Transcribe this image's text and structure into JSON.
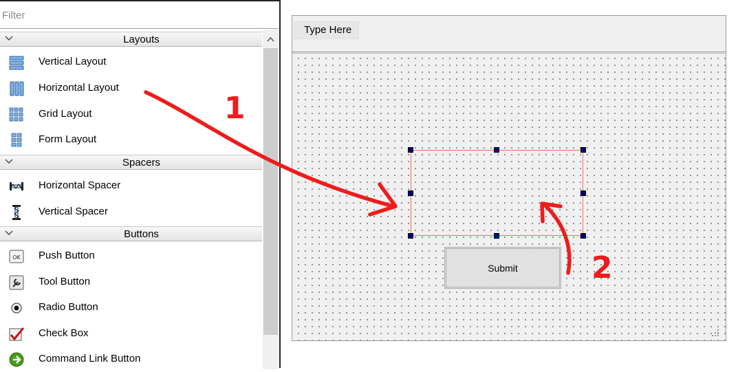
{
  "widget_box": {
    "filter_placeholder": "Filter",
    "categories": [
      {
        "label": "Layouts",
        "items": [
          "Vertical Layout",
          "Horizontal Layout",
          "Grid Layout",
          "Form Layout"
        ]
      },
      {
        "label": "Spacers",
        "items": [
          "Horizontal Spacer",
          "Vertical Spacer"
        ]
      },
      {
        "label": "Buttons",
        "items": [
          "Push Button",
          "Tool Button",
          "Radio Button",
          "Check Box",
          "Command Link Button"
        ]
      }
    ],
    "ok_icon_text": "OK"
  },
  "form": {
    "menu_placeholder": "Type Here",
    "submit_label": "Submit"
  },
  "annotations": {
    "step1": "1",
    "step2": "2",
    "color": "#ee1c1c"
  },
  "colors": {
    "selection_border": "#ff6b6b",
    "handle": "#000080"
  }
}
